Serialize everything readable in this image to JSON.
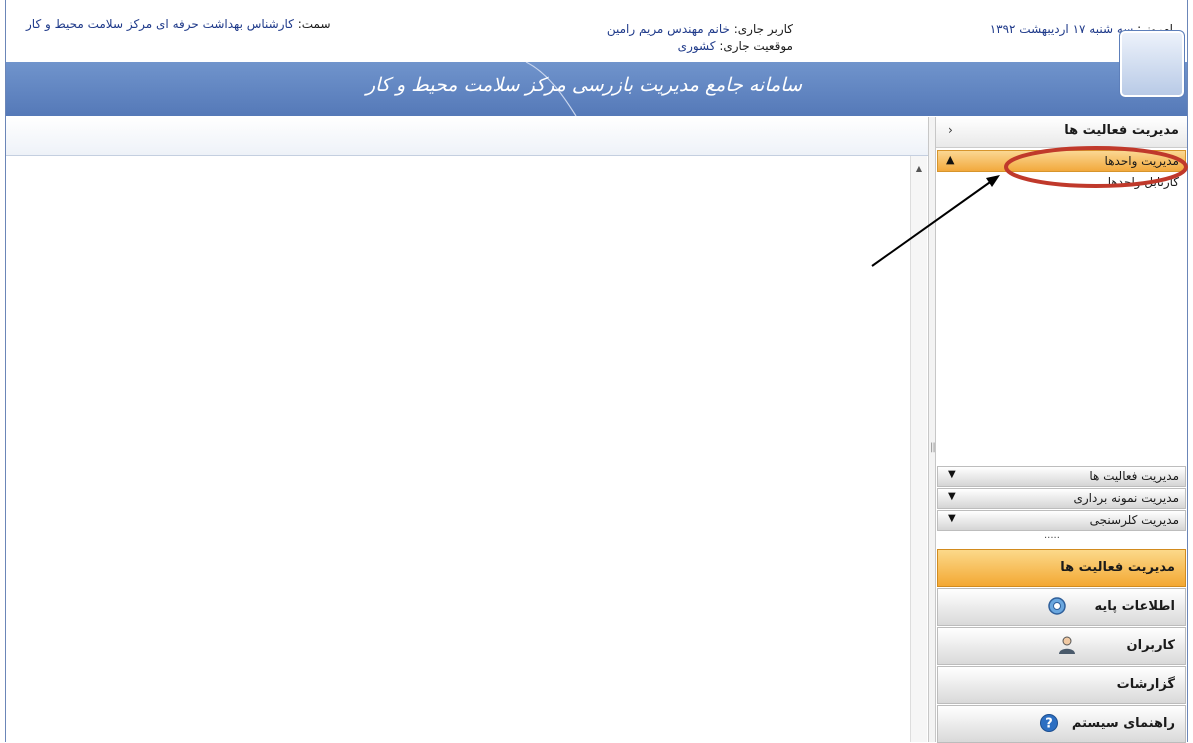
{
  "header": {
    "today_label": "امروز :",
    "today_value": "سه شنبه ۱۷ اردیبهشت ۱۳۹۲",
    "user_label": "کاربر جاری:",
    "user_value": "خانم مهندس مریم رامین",
    "location_label": "موقعیت جاری:",
    "location_value": "کشوری",
    "role_label": "سمت:",
    "role_value": "کارشناس بهداشت حرفه ای مرکز سلامت محیط و کار",
    "banner_title": "سامانه جامع مدیریت بازرسی مرکز سلامت محیط و کار"
  },
  "sidebar": {
    "title": "مدیریت فعالیت ها",
    "open_group": "مدیریت واحدها",
    "open_group_items": [
      "کارتابل واحدها"
    ],
    "collapsed_groups": [
      "مدیریت فعالیت ها",
      "مدیریت نمونه برداری",
      "مدیریت کلرسنجی"
    ],
    "grip": "....."
  },
  "modules": [
    {
      "label": "مدیریت فعالیت ها",
      "icon": ""
    },
    {
      "label": "اطلاعات پایه",
      "icon": "gear-icon"
    },
    {
      "label": "کاربران",
      "icon": "user-icon"
    },
    {
      "label": "گزارشات",
      "icon": ""
    },
    {
      "label": "راهنمای سیستم",
      "icon": "help-icon"
    }
  ],
  "active_module": "مدیریت فعالیت ها",
  "colors": {
    "banner": "#5579b8",
    "active_orange": "#f3a833",
    "annotation_red": "#c0392b"
  }
}
